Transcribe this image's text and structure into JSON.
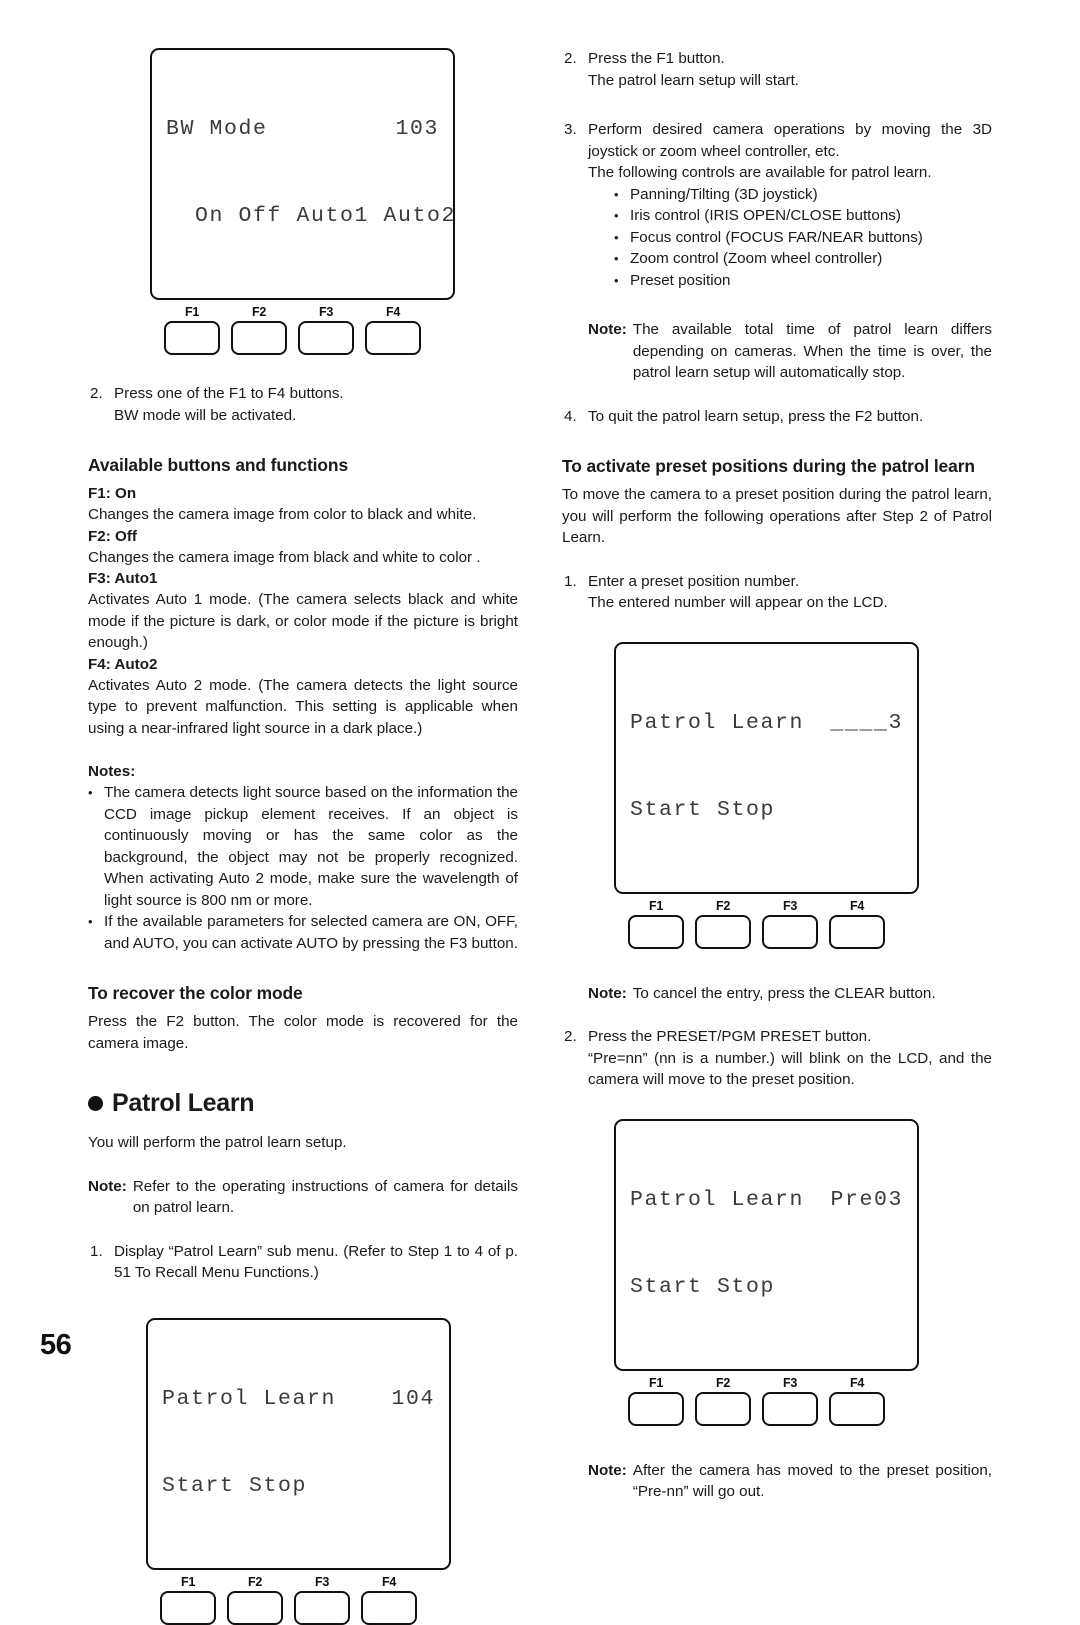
{
  "page": {
    "number": "56"
  },
  "lcd_bw_mode": {
    "line1_left": "BW Mode",
    "line1_right": "103",
    "line2": "  On Off Auto1 Auto2",
    "buttons": [
      "F1",
      "F2",
      "F3",
      "F4"
    ]
  },
  "lcd_patrol_104": {
    "line1_left": "Patrol Learn",
    "line1_right": "104",
    "line2": "Start Stop",
    "buttons": [
      "F1",
      "F2",
      "F3",
      "F4"
    ]
  },
  "lcd_patrol_entry": {
    "line1_left": "Patrol Learn",
    "line1_right": "____3",
    "line2": "Start Stop",
    "buttons": [
      "F1",
      "F2",
      "F3",
      "F4"
    ]
  },
  "lcd_patrol_pre03": {
    "line1_left": "Patrol Learn",
    "line1_right": "Pre03",
    "line2": "Start Stop",
    "buttons": [
      "F1",
      "F2",
      "F3",
      "F4"
    ]
  },
  "left": {
    "step2": {
      "num": "2.",
      "line1": "Press one of the F1 to F4 buttons.",
      "line2": "BW mode will be activated."
    },
    "available_heading": "Available buttons and functions",
    "functions": [
      {
        "label": "F1: On",
        "desc": "Changes the camera image from color to black and white."
      },
      {
        "label": "F2: Off",
        "desc": "Changes the camera image from black and white to color ."
      },
      {
        "label": "F3: Auto1",
        "desc": "Activates Auto 1 mode. (The camera selects black and white mode if the picture is dark, or color mode if the picture is bright enough.)"
      },
      {
        "label": "F4: Auto2",
        "desc": "Activates Auto 2 mode. (The camera detects the light source type to prevent malfunction. This setting is applicable when using a near-infrared light source in a dark place.)"
      }
    ],
    "notes_heading": "Notes:",
    "notes": [
      "The camera detects light source based on the information the CCD image pickup element receives. If an object is continuously moving or has the same color as the background, the  object may not be properly recognized. When activating Auto 2 mode, make sure the wavelength of light source is 800 nm or more.",
      "If the available parameters for selected camera are ON, OFF, and AUTO, you can activate AUTO by pressing the F3 button."
    ],
    "recover_heading": "To recover the color mode",
    "recover_body": "Press the F2 button. The color mode is recovered for the camera image.",
    "patrol_heading": "Patrol Learn",
    "patrol_intro": "You will perform the patrol learn setup.",
    "patrol_note": {
      "label": "Note:",
      "text": "Refer to the operating instructions of camera for details on patrol learn."
    },
    "patrol_step1": {
      "num": "1.",
      "text": "Display “Patrol Learn” sub menu. (Refer to Step 1 to 4 of p. 51 To Recall Menu Functions.)"
    }
  },
  "right": {
    "step2": {
      "num": "2.",
      "line1": "Press the F1 button.",
      "line2": "The patrol learn setup will start."
    },
    "step3": {
      "num": "3.",
      "line1": "Perform desired camera operations by moving the 3D joystick or zoom wheel controller, etc.",
      "line2": "The following controls are available for patrol learn.",
      "bullets": [
        "Panning/Tilting (3D joystick)",
        "Iris control (IRIS OPEN/CLOSE buttons)",
        "Focus control (FOCUS FAR/NEAR buttons)",
        "Zoom control (Zoom wheel controller)",
        "Preset position"
      ]
    },
    "note_time": {
      "label": "Note:",
      "text": "The available total time of patrol learn differs depending on cameras. When the time is over, the patrol learn setup will automatically stop."
    },
    "step4": {
      "num": "4.",
      "text": "To quit the patrol learn setup, press the F2 button."
    },
    "preset_heading": "To activate preset positions during the patrol learn",
    "preset_body": "To move the camera to a preset position during the patrol learn, you will perform the following operations after Step 2 of Patrol Learn.",
    "preset_step1": {
      "num": "1.",
      "line1": "Enter a preset position number.",
      "line2": "The entered number will appear on the LCD."
    },
    "note_clear": {
      "label": "Note:",
      "text": "To cancel the entry, press the CLEAR button."
    },
    "preset_step2": {
      "num": "2.",
      "line1": "Press the PRESET/PGM PRESET button.",
      "line2": "“Pre=nn” (nn is a number.) will blink on the LCD, and the camera will move to the preset position."
    },
    "note_moved": {
      "label": "Note:",
      "text": "After the camera has moved to the preset position, “Pre-nn” will go out."
    }
  }
}
